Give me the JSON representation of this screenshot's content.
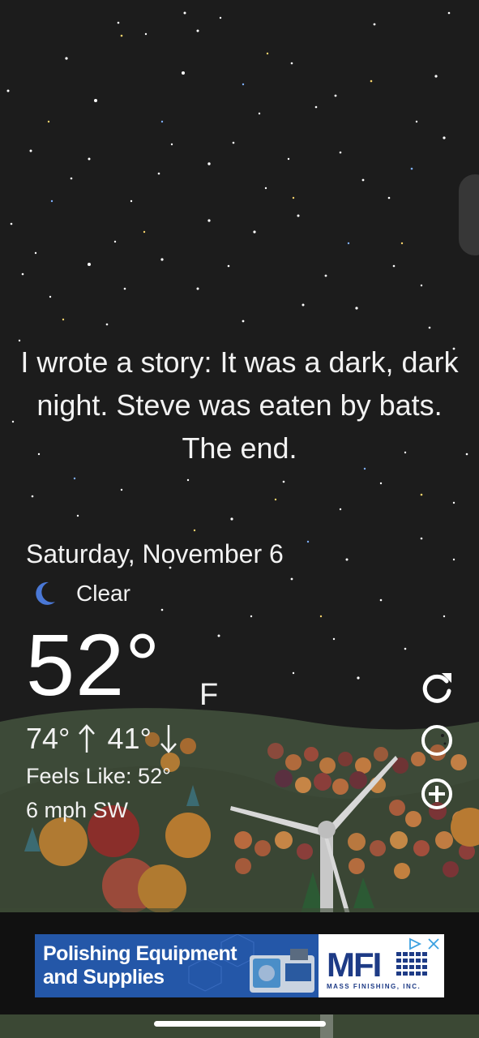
{
  "joke": "I wrote a story: It was a dark, dark night. Steve was eaten by bats. The end.",
  "weather": {
    "date": "Saturday, November 6",
    "condition": "Clear",
    "condition_icon": "crescent-moon-icon",
    "temperature": "52°",
    "unit": "F",
    "high": "74°",
    "low": "41°",
    "feels_like": "Feels Like: 52°",
    "wind": "6 mph SW"
  },
  "side_actions": [
    {
      "name": "refresh-icon"
    },
    {
      "name": "theme-toggle-icon"
    },
    {
      "name": "add-location-icon"
    }
  ],
  "ad": {
    "headline_line1": "Polishing Equipment",
    "headline_line2": "and Supplies",
    "logo_text": "MFI",
    "logo_subtext": "MASS FINISHING, INC.",
    "accent_color": "#2457a8"
  },
  "colors": {
    "background": "#1c1c1c",
    "moon": "#4a78d6",
    "ad_logo": "#1e3b86"
  }
}
